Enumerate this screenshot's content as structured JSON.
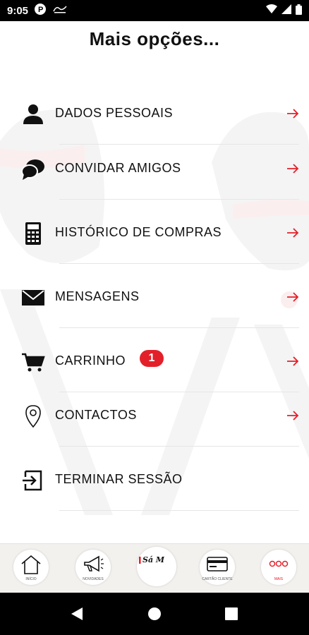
{
  "status_bar": {
    "time": "9:05"
  },
  "page": {
    "title": "Mais opções..."
  },
  "menu": {
    "items": [
      {
        "label": "DADOS PESSOAIS",
        "icon": "person-icon"
      },
      {
        "label": "CONVIDAR AMIGOS",
        "icon": "chat-bubbles-icon"
      },
      {
        "label": "HISTÓRICO DE COMPRAS",
        "icon": "calculator-icon"
      },
      {
        "label": "MENSAGENS",
        "icon": "envelope-icon"
      },
      {
        "label": "CARRINHO",
        "icon": "cart-icon",
        "badge": "1"
      },
      {
        "label": "CONTACTOS",
        "icon": "location-pin-icon"
      },
      {
        "label": "TERMINAR SESSÃO",
        "icon": "logout-icon"
      }
    ]
  },
  "tabbar": {
    "items": [
      {
        "label": "INÍCIO",
        "icon": "home-icon"
      },
      {
        "label": "NOVIDADES",
        "icon": "megaphone-icon"
      },
      {
        "label": "Sá Morais",
        "icon": "brand-logo"
      },
      {
        "label": "CARTÃO CLIENTE",
        "icon": "card-icon"
      },
      {
        "label": "MAIS",
        "icon": "more-icon",
        "active": true
      }
    ]
  },
  "colors": {
    "accent": "#e3202a",
    "text": "#111111",
    "tabbar_bg": "#f3f1ee"
  }
}
